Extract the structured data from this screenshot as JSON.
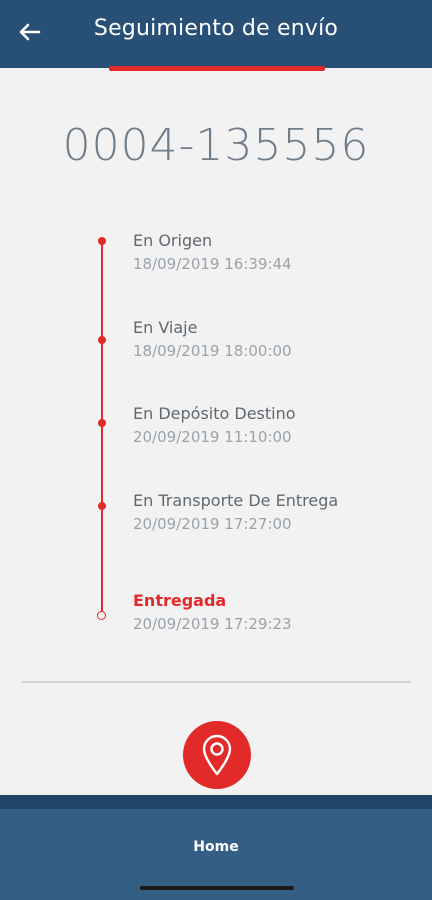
{
  "header": {
    "title": "Seguimiento de envío",
    "back_icon": "arrow-left-icon"
  },
  "shipment": {
    "tracking_number": "0004-135556"
  },
  "timeline": [
    {
      "status": "En Origen",
      "date": "18/09/2019 16:39:44"
    },
    {
      "status": "En Viaje",
      "date": "18/09/2019 18:00:00"
    },
    {
      "status": "En Depósito Destino",
      "date": "20/09/2019 11:10:00"
    },
    {
      "status": "En Transporte De Entrega",
      "date": "20/09/2019 17:27:00"
    },
    {
      "status": "Entregada",
      "date": "20/09/2019 17:29:23"
    }
  ],
  "map_button": {
    "icon": "location-pin-icon"
  },
  "bottom_nav": {
    "home_label": "Home"
  },
  "colors": {
    "header": "#284f75",
    "accent": "#e32a2a",
    "bottom_bar": "#345e84"
  }
}
